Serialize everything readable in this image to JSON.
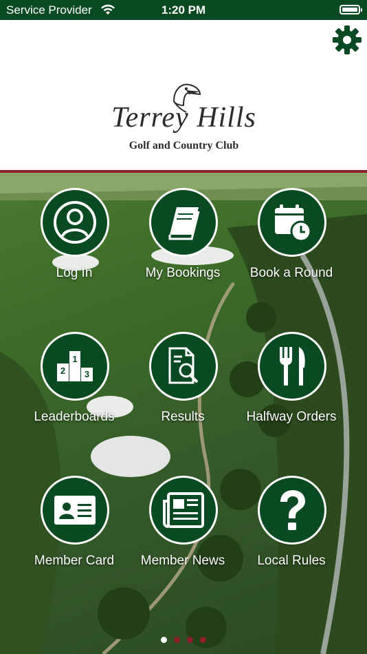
{
  "status_bar": {
    "carrier": "Service Provider",
    "time": "1:20 PM"
  },
  "header": {
    "logo_script": "Terrey Hills",
    "logo_subtitle": "Golf and Country Club"
  },
  "tiles": [
    {
      "label": "Log In",
      "icon": "person-icon"
    },
    {
      "label": "My Bookings",
      "icon": "book-icon"
    },
    {
      "label": "Book a Round",
      "icon": "calendar-clock-icon"
    },
    {
      "label": "Leaderboards",
      "icon": "podium-icon"
    },
    {
      "label": "Results",
      "icon": "document-search-icon"
    },
    {
      "label": "Halfway Orders",
      "icon": "fork-knife-icon"
    },
    {
      "label": "Member Card",
      "icon": "id-card-icon"
    },
    {
      "label": "Member News",
      "icon": "newspaper-icon"
    },
    {
      "label": "Local Rules",
      "icon": "question-icon"
    }
  ],
  "pager": {
    "pages": 4,
    "current": 1
  },
  "colors": {
    "brand_green": "#0a4a23",
    "accent_maroon": "#8e1f2c",
    "status_bar": "#0a4a23"
  }
}
